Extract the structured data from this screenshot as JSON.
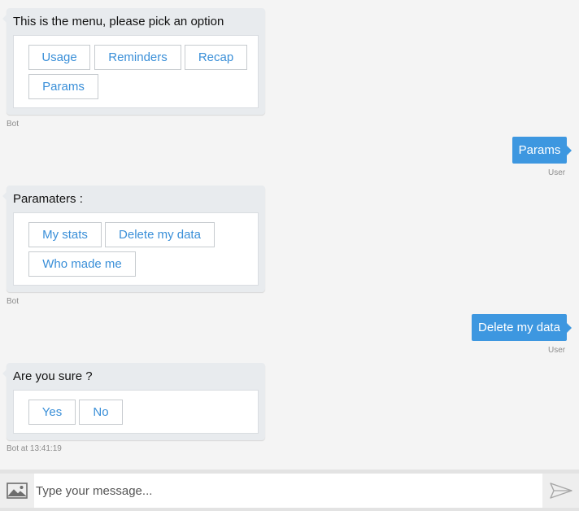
{
  "colors": {
    "accent": "#3d97e0",
    "bot_bubble": "#e8ebee",
    "button_text": "#3a8fd8",
    "meta_text": "#8d8d8d"
  },
  "messages": [
    {
      "from": "bot",
      "text": "This is the menu, please pick an option",
      "buttons": [
        "Usage",
        "Reminders",
        "Recap",
        "Params"
      ],
      "meta": "Bot"
    },
    {
      "from": "user",
      "text": "Params",
      "meta": "User"
    },
    {
      "from": "bot",
      "text": "Paramaters :",
      "buttons": [
        "My stats",
        "Delete my data",
        "Who made me"
      ],
      "meta": "Bot"
    },
    {
      "from": "user",
      "text": "Delete my data",
      "meta": "User"
    },
    {
      "from": "bot",
      "text": "Are you sure ?",
      "buttons": [
        "Yes",
        "No"
      ],
      "meta": "Bot at 13:41:19"
    }
  ],
  "composer": {
    "placeholder": "Type your message...",
    "image_icon": "image-icon",
    "send_icon": "send-icon"
  }
}
